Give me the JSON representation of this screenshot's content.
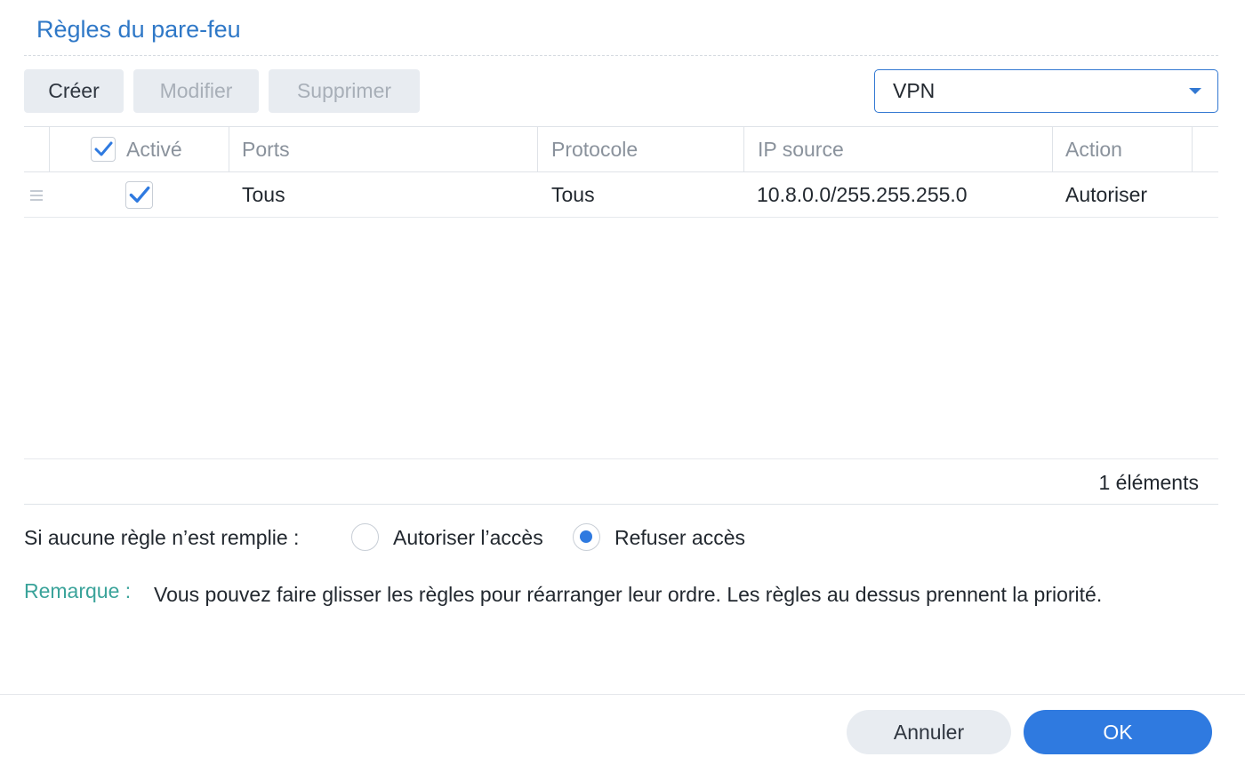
{
  "dialog": {
    "title": "Règles du pare-feu"
  },
  "toolbar": {
    "create_label": "Créer",
    "edit_label": "Modifier",
    "delete_label": "Supprimer",
    "profile_select": "VPN"
  },
  "table": {
    "columns": [
      "Activé",
      "Ports",
      "Protocole",
      "IP source",
      "Action"
    ],
    "header_all_checked": true,
    "rows": [
      {
        "enabled": true,
        "ports": "Tous",
        "protocol": "Tous",
        "source_ip": "10.8.0.0/255.255.255.0",
        "action": "Autoriser"
      }
    ],
    "count_label": "1 éléments"
  },
  "policy": {
    "label": "Si aucune règle n’est remplie :",
    "options": [
      "Autoriser l’accès",
      "Refuser accès"
    ],
    "selected": "Refuser accès"
  },
  "note": {
    "label": "Remarque :",
    "text": "Vous pouvez faire glisser les règles pour réarranger leur ordre. Les règles au dessus prennent la priorité."
  },
  "footer": {
    "cancel_label": "Annuler",
    "ok_label": "OK"
  },
  "colors": {
    "accent": "#2f7ae0",
    "title": "#2f78c7",
    "note_label": "#3aa39a"
  },
  "icons": {
    "header_checkbox": "check-icon",
    "row_checkbox": "check-icon",
    "drag_handle": "drag-handle-icon",
    "dropdown": "chevron-down-icon"
  }
}
